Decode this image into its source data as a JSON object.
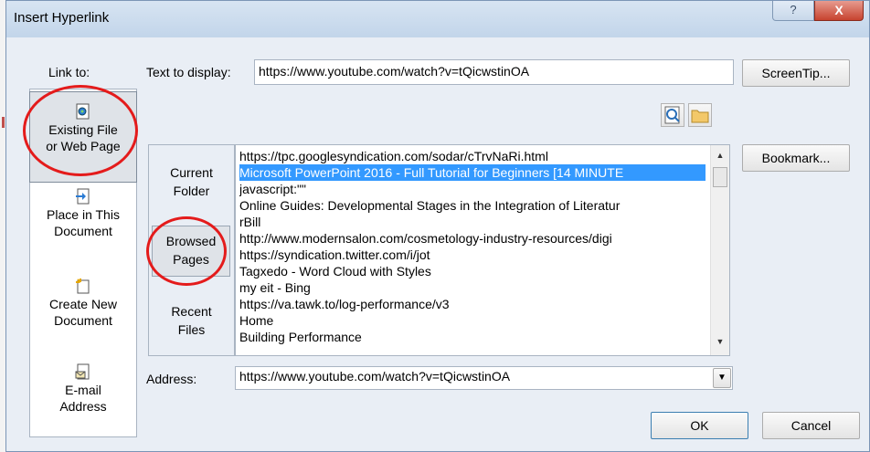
{
  "dialog": {
    "title": "Insert Hyperlink",
    "help_label": "?",
    "close_label": "X"
  },
  "link_to": {
    "label": "Link to:",
    "items": [
      {
        "line1": "Existing File",
        "line2": "or Web Page",
        "icon": "web-page-icon",
        "selected": true
      },
      {
        "line1": "Place in This",
        "line2": "Document",
        "icon": "document-place-icon",
        "selected": false
      },
      {
        "line1": "Create New",
        "line2": "Document",
        "icon": "new-document-icon",
        "selected": false
      },
      {
        "line1": "E-mail",
        "line2": "Address",
        "icon": "email-icon",
        "selected": false
      }
    ]
  },
  "text_to_display": {
    "label": "Text to display:",
    "value": "https://www.youtube.com/watch?v=tQicwstinOA"
  },
  "buttons": {
    "screentip": "ScreenTip...",
    "bookmark": "Bookmark...",
    "ok": "OK",
    "cancel": "Cancel"
  },
  "look_in": {
    "items": [
      {
        "line1": "Current",
        "line2": "Folder",
        "selected": false
      },
      {
        "line1": "Browsed",
        "line2": "Pages",
        "selected": true
      },
      {
        "line1": "Recent",
        "line2": "Files",
        "selected": false
      }
    ]
  },
  "file_list": {
    "rows": [
      "https://tpc.googlesyndication.com/sodar/cTrvNaRi.html",
      "Microsoft PowerPoint 2016 - Full Tutorial for Beginners [14 MINUTE",
      "javascript:\"\"",
      "Online Guides: Developmental Stages in the Integration of Literatur",
      "rBill",
      "http://www.modernsalon.com/cosmetology-industry-resources/digi",
      "https://syndication.twitter.com/i/jot",
      "Tagxedo - Word Cloud with Styles",
      "my eit - Bing",
      "https://va.tawk.to/log-performance/v3",
      "Home",
      "Building Performance"
    ],
    "selected_index": 1
  },
  "address": {
    "label": "Address:",
    "value": "https://www.youtube.com/watch?v=tQicwstinOA"
  },
  "colors": {
    "selection": "#3399ff",
    "annotation_ring": "#e41b1b"
  }
}
